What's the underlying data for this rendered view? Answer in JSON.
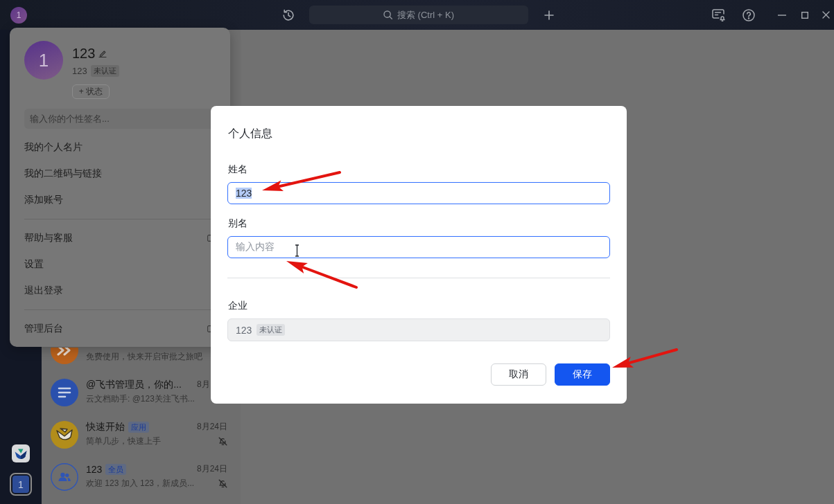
{
  "title_bar": {
    "avatar": {
      "initial": "1"
    },
    "search": {
      "placeholder": "搜索 (Ctrl + K)"
    }
  },
  "sidebar": {
    "account": {
      "initial": "1"
    }
  },
  "chat_list": {
    "items": [
      {
        "kind": "approval",
        "subtitle": "免费使用，快来开启审批之旅吧"
      },
      {
        "kind": "doc",
        "title": "@飞书管理员，你的...",
        "time": "8月",
        "subtitle": "云文档助手: @123关注飞书..."
      },
      {
        "kind": "app",
        "title": "快速开始",
        "badge": "应用",
        "time": "8月24日",
        "subtitle": "简单几步，快速上手",
        "muted": true
      },
      {
        "kind": "group",
        "title": "123",
        "badge": "全员",
        "time": "8月24日",
        "subtitle": "欢迎 123 加入 123，新成员...",
        "muted": true
      }
    ]
  },
  "profile_menu": {
    "avatar": {
      "initial": "1"
    },
    "name": "123",
    "tenant": {
      "name": "123",
      "badge": "未认证"
    },
    "status_button": "+ 状态",
    "signature": {
      "placeholder": "输入你的个性签名..."
    },
    "sections": [
      {
        "items": [
          {
            "label": "我的个人名片",
            "kind": "plain"
          },
          {
            "label": "我的二维码与链接",
            "kind": "plain"
          },
          {
            "label": "添加账号",
            "kind": "plain"
          }
        ]
      },
      {
        "items": [
          {
            "label": "帮助与客服",
            "kind": "external"
          },
          {
            "label": "设置",
            "kind": "plain"
          },
          {
            "label": "退出登录",
            "kind": "plain"
          }
        ]
      },
      {
        "items": [
          {
            "label": "管理后台",
            "kind": "external"
          }
        ]
      }
    ]
  },
  "dialog": {
    "title": "个人信息",
    "sections": [
      {
        "fields": [
          {
            "kind": "input",
            "label": "姓名",
            "value": "123",
            "value_selected": true,
            "focused": true
          },
          {
            "kind": "input",
            "label": "别名",
            "placeholder": "输入内容",
            "focused": true,
            "pointer_over": true
          }
        ]
      },
      {
        "fields": [
          {
            "kind": "readonly",
            "label": "企业",
            "value": "123",
            "badge": "未认证",
            "disabled": true
          }
        ]
      }
    ],
    "buttons": [
      {
        "label": "取消",
        "kind": "secondary"
      },
      {
        "label": "保存",
        "kind": "primary"
      }
    ]
  },
  "annotations": [
    {
      "kind": "arrow"
    },
    {
      "kind": "arrow"
    },
    {
      "kind": "arrow"
    }
  ]
}
